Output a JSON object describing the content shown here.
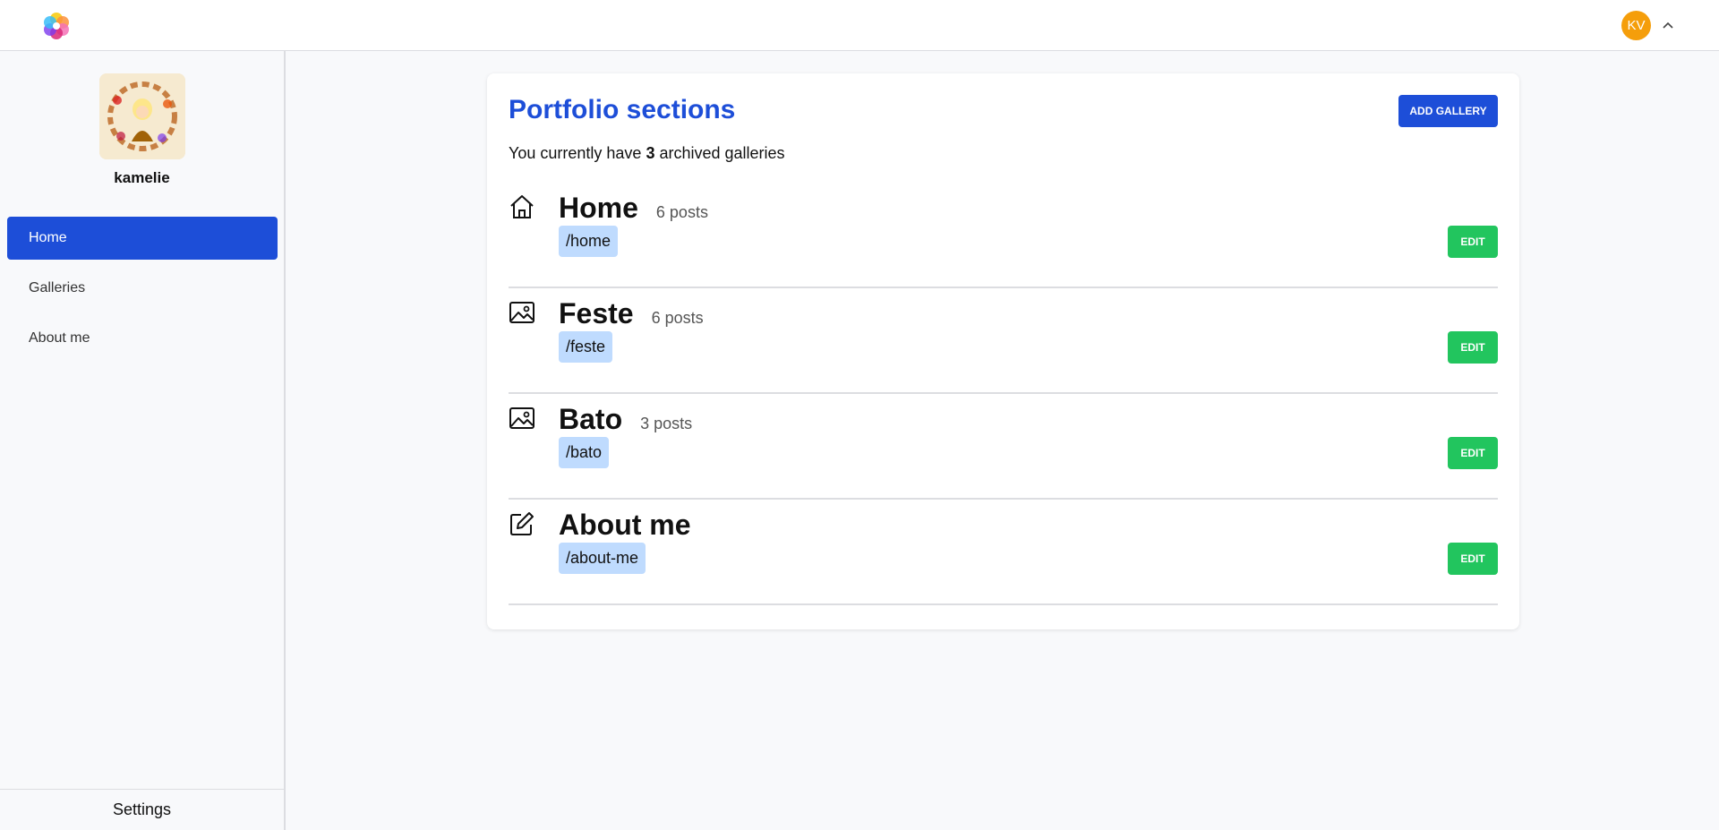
{
  "header": {
    "logo_icon": "pinwheel-logo",
    "user_initials": "KV",
    "user_avatar_color": "#f59e0b",
    "menu_icon": "chevron-up-icon"
  },
  "sidebar": {
    "profile_name": "kamelie",
    "items": [
      {
        "label": "Home",
        "active": true
      },
      {
        "label": "Galleries",
        "active": false
      },
      {
        "label": "About me",
        "active": false
      }
    ],
    "settings_label": "Settings"
  },
  "main": {
    "title": "Portfolio sections",
    "add_button": "ADD GALLERY",
    "summary_prefix": "You currently have",
    "archived_count": "3",
    "summary_suffix": "archived galleries",
    "edit_label": "EDIT",
    "sections": [
      {
        "title": "Home",
        "count": "6 posts",
        "slug": "/home",
        "icon": "home-icon"
      },
      {
        "title": "Feste",
        "count": "6 posts",
        "slug": "/feste",
        "icon": "image-icon"
      },
      {
        "title": "Bato",
        "count": "3 posts",
        "slug": "/bato",
        "icon": "image-icon"
      },
      {
        "title": "About me",
        "count": "",
        "slug": "/about-me",
        "icon": "edit-icon"
      }
    ]
  },
  "colors": {
    "accent": "#1d4ed8",
    "edit": "#22c55e",
    "slug_bg": "#bfdbfe"
  }
}
